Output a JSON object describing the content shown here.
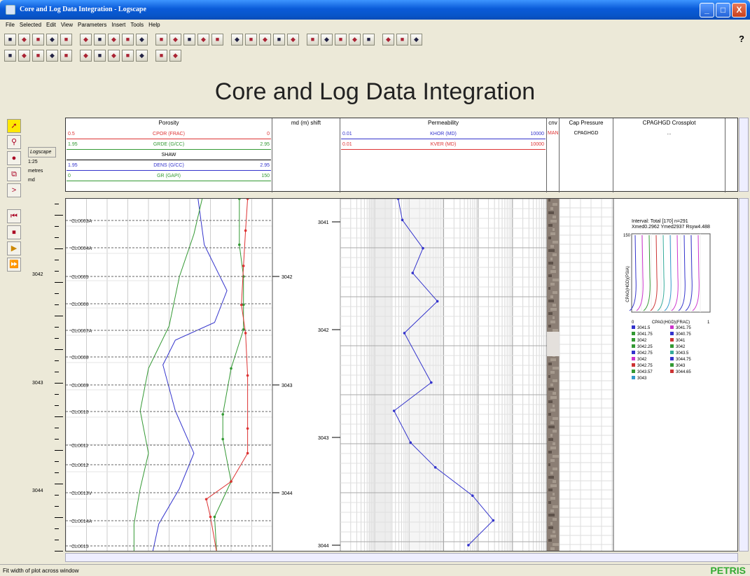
{
  "window": {
    "title": "Core and Log Data Integration - Logscape",
    "btns": [
      "_",
      "□",
      "X"
    ]
  },
  "menu": [
    "File",
    "Selected",
    "Edit",
    "View",
    "Parameters",
    "Insert",
    "Tools",
    "Help"
  ],
  "toolbar1": [
    "new",
    "open",
    "close",
    "save",
    "saveall",
    "t1",
    "t2",
    "t3",
    "t4",
    "t5",
    "t6",
    "t7",
    "t8",
    "t9",
    "t10",
    "t11",
    "t12",
    "t13",
    "t14",
    "t15",
    "undo",
    "redo",
    "cut",
    "copy",
    "paste",
    "delete",
    "print",
    "preview"
  ],
  "toolbar2": [
    "zoom-box",
    "track",
    "track2",
    "top",
    "bottom",
    "zoom-in",
    "zoom-out",
    "zoom-x",
    "zoom-y",
    "zoom-reset",
    "first",
    "last"
  ],
  "help": "?",
  "heading": "Core and Log Data Integration",
  "scale": {
    "app": "Logscape",
    "ratio": "1:25",
    "unit": "metres",
    "ref": "md"
  },
  "tracks": {
    "porosity": {
      "name": "Porosity",
      "rows": [
        {
          "l": "0.5",
          "c": "CPOR (FRAC)",
          "r": "0",
          "color": "#d33"
        },
        {
          "l": "1.95",
          "c": "GRDE (G/CC)",
          "r": "2.95",
          "color": "#393"
        },
        {
          "l": "",
          "c": "SHAW",
          "r": "",
          "color": "#000"
        },
        {
          "l": "1.95",
          "c": "DENS (G/CC)",
          "r": "2.95",
          "color": "#33c"
        },
        {
          "l": "0",
          "c": "GR (GAPI)",
          "r": "150",
          "color": "#393"
        }
      ]
    },
    "shift": {
      "name": "md (m) shift"
    },
    "perm": {
      "name": "Permeability",
      "rows": [
        {
          "l": "0.01",
          "c": "KHOR (MD)",
          "r": "10000",
          "color": "#33c"
        },
        {
          "l": "0.01",
          "c": "KVER (MD)",
          "r": "10000",
          "color": "#d33"
        }
      ]
    },
    "mini": {
      "name": "cnv",
      "label": "MAN"
    },
    "cap": {
      "name": "Cap Pressure",
      "label": "CPAGHGD"
    },
    "cross": {
      "name": "CPAGHGD Crossplot",
      "label": "..."
    }
  },
  "samples": [
    "CL0003A",
    "CL0004A",
    "CL0005",
    "CL0006",
    "CL0007A",
    "CL0008",
    "CL0009",
    "CL0010",
    "CL0011",
    "CL0012",
    "CL0013V",
    "CL0014A",
    "CL0015"
  ],
  "depths_left": [
    "3042",
    "3043",
    "3044"
  ],
  "depths_shift": [
    "3042",
    "3043",
    "3044"
  ],
  "depths_perm": [
    "3041",
    "3042",
    "3043",
    "3044"
  ],
  "crossplot": {
    "title": "Interval: Total [170]    n=291",
    "subtitle": "Xmed0.2962 Ymed2937 Rsyw4.488",
    "ylabel": "CPAG(HGD)(PSIA)",
    "xlabel": "CPAG(HGD)(FRAC)",
    "xticks": [
      "0",
      "1"
    ],
    "ymax": "150",
    "legend": [
      [
        "3041.5",
        "#33c"
      ],
      [
        "3041.75",
        "#c3c"
      ],
      [
        "3041.75",
        "#393"
      ],
      [
        "3040.75",
        "#33c"
      ],
      [
        "3042",
        "#393"
      ],
      [
        "3041",
        "#c33"
      ],
      [
        "3042.25",
        "#393"
      ],
      [
        "3042",
        "#393"
      ],
      [
        "3042.75",
        "#33c"
      ],
      [
        "3043.5",
        "#3a9"
      ],
      [
        "3042",
        "#c3c"
      ],
      [
        "3044.75",
        "#33c"
      ],
      [
        "3042.75",
        "#c33"
      ],
      [
        "3043",
        "#393"
      ],
      [
        "3043.57",
        "#393"
      ],
      [
        "3044.65",
        "#c33"
      ],
      [
        "3043",
        "#39c"
      ]
    ]
  },
  "status": "Fit width of plot across window",
  "brand": "PETRIS"
}
